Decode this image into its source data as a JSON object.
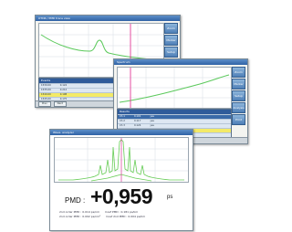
{
  "window1": {
    "title": "OTDR / PMD trace view",
    "side_buttons": [
      "Zoom",
      "Marker",
      "Setup",
      "Spectrum",
      "Analysis",
      "Print"
    ],
    "table_header": "Events",
    "rows": [
      [
        "1530.00",
        "0.124"
      ],
      [
        "1535.00",
        "0.212"
      ],
      [
        "1540.00",
        "0.198"
      ],
      [
        "1545.00",
        "0.175"
      ],
      [
        "1550.00",
        "0.161"
      ],
      [
        "1555.00",
        "0.143"
      ],
      [
        "1560.00",
        "0.132"
      ],
      [
        "1565.00",
        "0.128"
      ]
    ],
    "footer_buttons": [
      "Prev",
      "Next"
    ]
  },
  "window2": {
    "title": "Spectrum",
    "side_buttons": [
      "Zoom",
      "Marker",
      "Setup",
      "Analysis",
      "Print"
    ],
    "table_header": "Results",
    "rows": [
      [
        "Ch 1",
        "0.101",
        "yes"
      ],
      [
        "Ch 2",
        "0.117",
        "yes"
      ],
      [
        "Ch 3",
        "0.124",
        "yes"
      ],
      [
        "Ch 4",
        "0.140",
        "yes"
      ],
      [
        "Ch 5",
        "0.152",
        "yes"
      ],
      [
        "Ch 6",
        "0.159",
        "yes"
      ],
      [
        "Ch 7",
        "0.166",
        "yes"
      ]
    ],
    "footer_buttons": [
      "Prev",
      "Next",
      "File"
    ]
  },
  "window3": {
    "title": "Wave. analyzer",
    "pmd_label": "PMD :",
    "pmd_value": "+0,959",
    "pmd_unit": "ps",
    "details": [
      [
        "2nd order PMD : 0.014 ps/nm",
        "Coef PMD : 0.181 ps/km"
      ],
      [
        "2nd order PMD : 0.002 ps/nm²",
        "Coef 2nd PMD : 0.004 ps/km"
      ]
    ]
  }
}
